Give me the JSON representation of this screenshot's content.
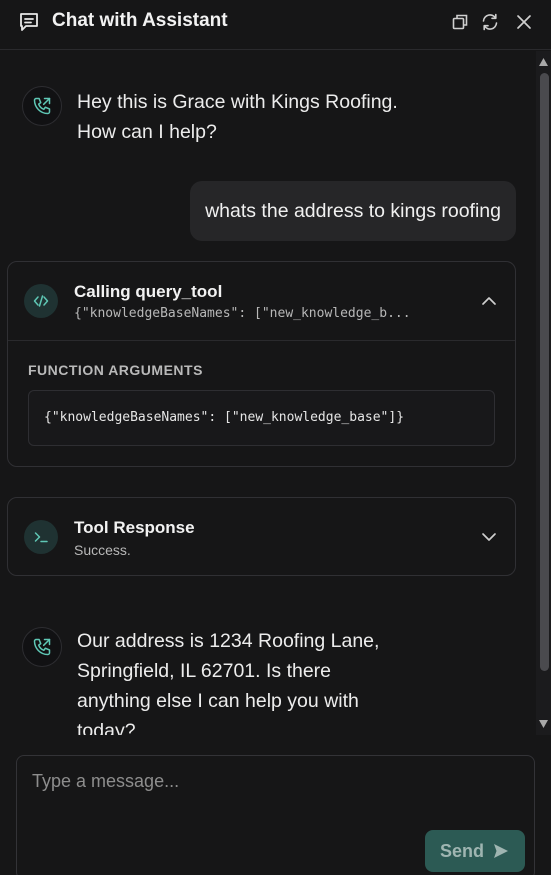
{
  "header": {
    "title": "Chat with Assistant",
    "icons": [
      "chat-icon",
      "restore-icon",
      "refresh-icon",
      "close-icon"
    ]
  },
  "messages": {
    "bot_1": {
      "lines": [
        "Hey this is Grace with Kings Roofing.",
        "How can I help?"
      ]
    },
    "user_1": {
      "text": "whats the address to kings roofing"
    },
    "tool_call": {
      "title": "Calling query_tool",
      "preview": "{\"knowledgeBaseNames\": [\"new_knowledge_b...",
      "section_label": "FUNCTION ARGUMENTS",
      "arguments": "{\"knowledgeBaseNames\": [\"new_knowledge_base\"]}",
      "expanded": true
    },
    "tool_response": {
      "title": "Tool Response",
      "status": "Success.",
      "expanded": false
    },
    "bot_2": {
      "lines": [
        "Our address is 1234 Roofing Lane,",
        "Springfield, IL 62701. Is there",
        "anything else I can help you with",
        "today?"
      ]
    }
  },
  "composer": {
    "placeholder": "Type a message...",
    "value": "",
    "send_label": "Send"
  },
  "colors": {
    "background": "#161617",
    "accent": "#2c5a54",
    "icon_teal": "#5fc7b5"
  }
}
